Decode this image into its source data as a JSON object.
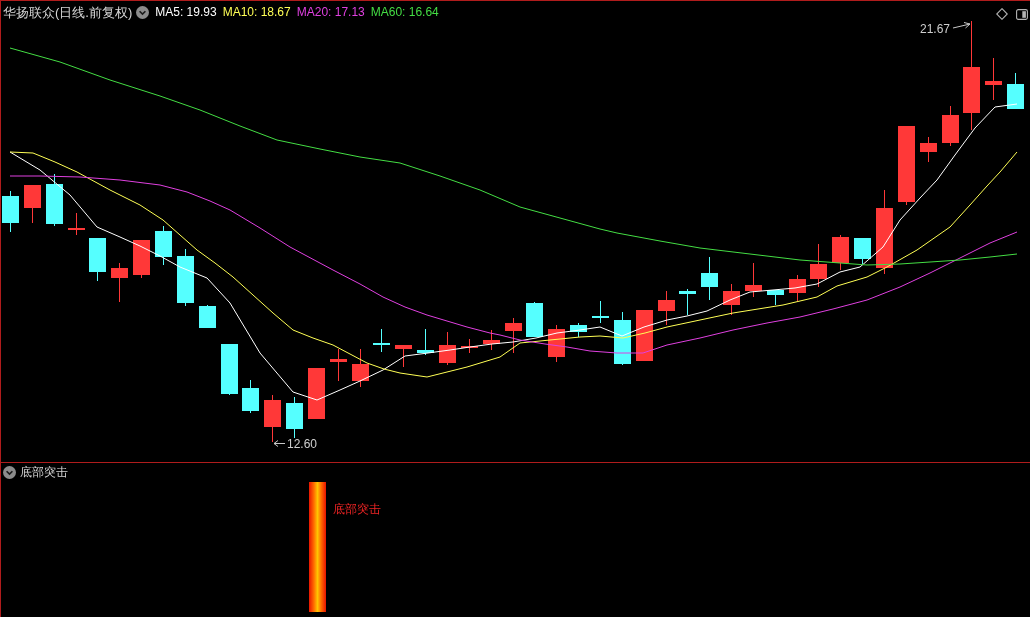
{
  "main_panel": {
    "title": "华扬联众(日线.前复权)",
    "indicators": [
      {
        "label": "MA5: 19.93",
        "color": "#ffffff"
      },
      {
        "label": "MA10: 18.67",
        "color": "#ffff55"
      },
      {
        "label": "MA20: 17.13",
        "color": "#e040e0"
      },
      {
        "label": "MA60: 16.64",
        "color": "#44dd44"
      }
    ],
    "high_label": "21.67",
    "low_label": "12.60"
  },
  "signal_panel": {
    "title": "底部突击",
    "signal_label": "底部突击"
  }
}
